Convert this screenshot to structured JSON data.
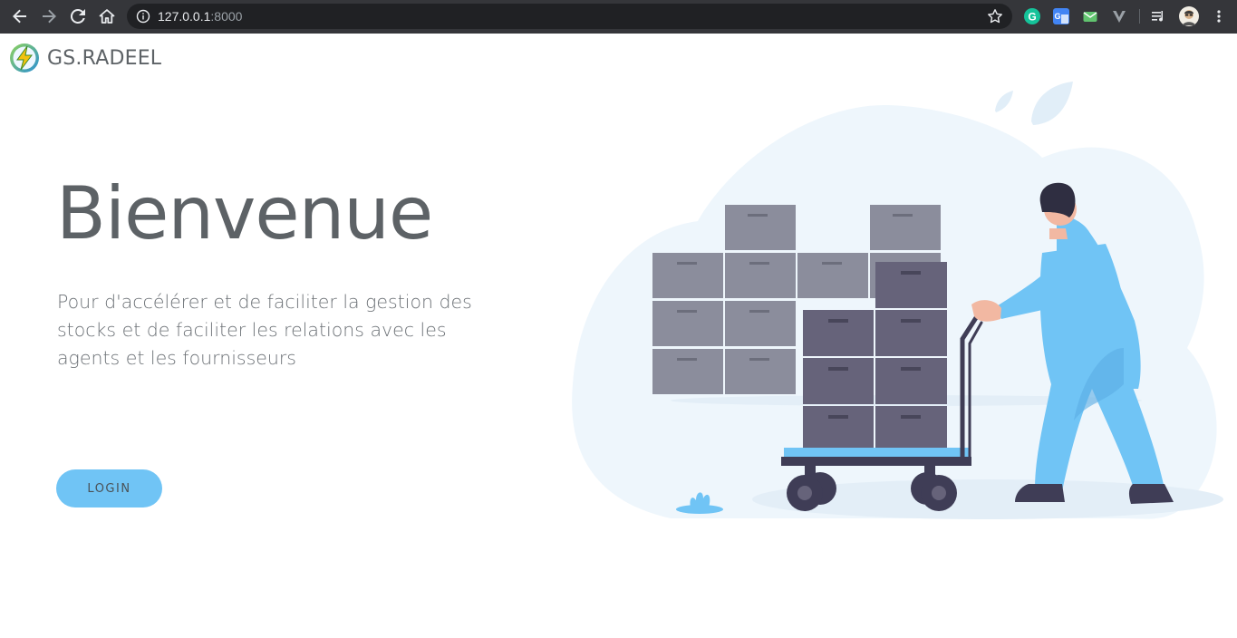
{
  "browser": {
    "url_host": "127.0.0.1",
    "url_port": ":8000"
  },
  "brand": {
    "name": "GS.RADEEL"
  },
  "hero": {
    "title": "Bienvenue",
    "description": "Pour d'accélérer et de faciliter la gestion des stocks et de faciliter les relations avec les agents et les fournisseurs",
    "login_label": "LOGIN"
  },
  "colors": {
    "accent": "#70c4f5",
    "text": "#5d6266",
    "cloud": "#eef6fc"
  },
  "icons": [
    "back-icon",
    "forward-icon",
    "reload-icon",
    "home-icon",
    "info-icon",
    "star-icon",
    "grammarly-icon",
    "translate-icon",
    "mail-icon",
    "vivaldi-icon",
    "playlist-icon",
    "profile-avatar",
    "more-icon"
  ]
}
